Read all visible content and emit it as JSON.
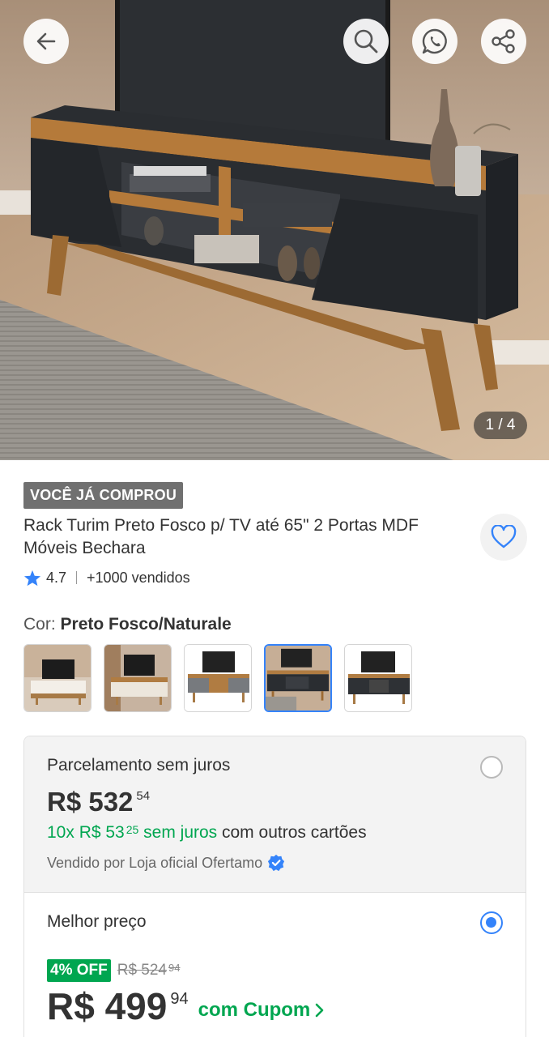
{
  "gallery": {
    "counter": "1 / 4"
  },
  "product": {
    "badge": "VOCÊ JÁ COMPROU",
    "title": "Rack Turim Preto Fosco p/ TV até 65\" 2 Portas MDF Móveis Bechara",
    "rating": "4.7",
    "sold": "+1000 vendidos",
    "color_label": "Cor: ",
    "color_value": "Preto Fosco/Naturale",
    "swatch_selected_index": 3
  },
  "payment": {
    "option1": {
      "title": "Parcelamento sem juros",
      "price_main": "R$ 532",
      "price_cents": "54",
      "installments_count": "10x R$ 53",
      "installments_cents": "25",
      "installments_green_tail": " sem juros",
      "installments_tail": " com outros cartões",
      "seller": "Vendido por Loja oficial Ofertamo"
    },
    "option2": {
      "title": "Melhor preço",
      "discount": "4% OFF",
      "old_main": "R$ 524",
      "old_cents": "94",
      "price_main": "R$ 499",
      "price_cents": "94",
      "coupon": "com Cupom"
    }
  },
  "colors": {
    "accent_blue": "#3483fa",
    "green": "#00a650",
    "badge_gray": "#707070"
  },
  "icons": [
    "back-arrow-icon",
    "search-icon",
    "whatsapp-icon",
    "share-icon",
    "heart-icon",
    "star-icon",
    "verified-icon",
    "chevron-right-icon"
  ]
}
